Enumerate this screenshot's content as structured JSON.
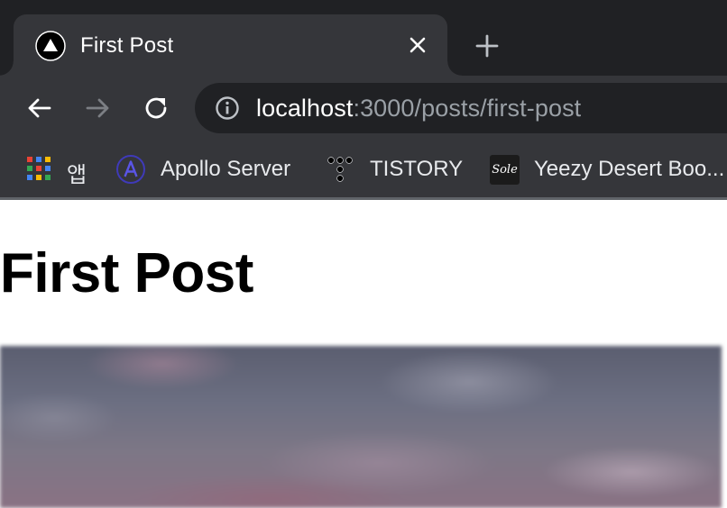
{
  "browser": {
    "tab": {
      "title": "First Post",
      "favicon": "nextjs-triangle-icon"
    },
    "new_tab_icon": "plus-icon",
    "toolbar": {
      "back_icon": "arrow-left-icon",
      "forward_icon": "arrow-right-icon",
      "reload_icon": "reload-icon",
      "site_info_icon": "info-icon",
      "url_host": "localhost",
      "url_path": ":3000/posts/first-post"
    },
    "bookmarks": [
      {
        "label": "앱",
        "icon": "apps-grid-icon"
      },
      {
        "label": "Apollo Server",
        "icon": "apollo-icon"
      },
      {
        "label": "TISTORY",
        "icon": "tistory-icon"
      },
      {
        "label": "Yeezy Desert Boo...",
        "icon": "sole-icon",
        "icon_text": "Sole"
      }
    ]
  },
  "page": {
    "heading": "First Post",
    "hero_image": "blurred-photo"
  },
  "colors": {
    "tabstrip_bg": "#202124",
    "toolbar_bg": "#35363a",
    "omnibox_bg": "#202124",
    "url_host": "#ffffff",
    "url_path": "#9aa0a6",
    "page_bg": "#ffffff"
  }
}
